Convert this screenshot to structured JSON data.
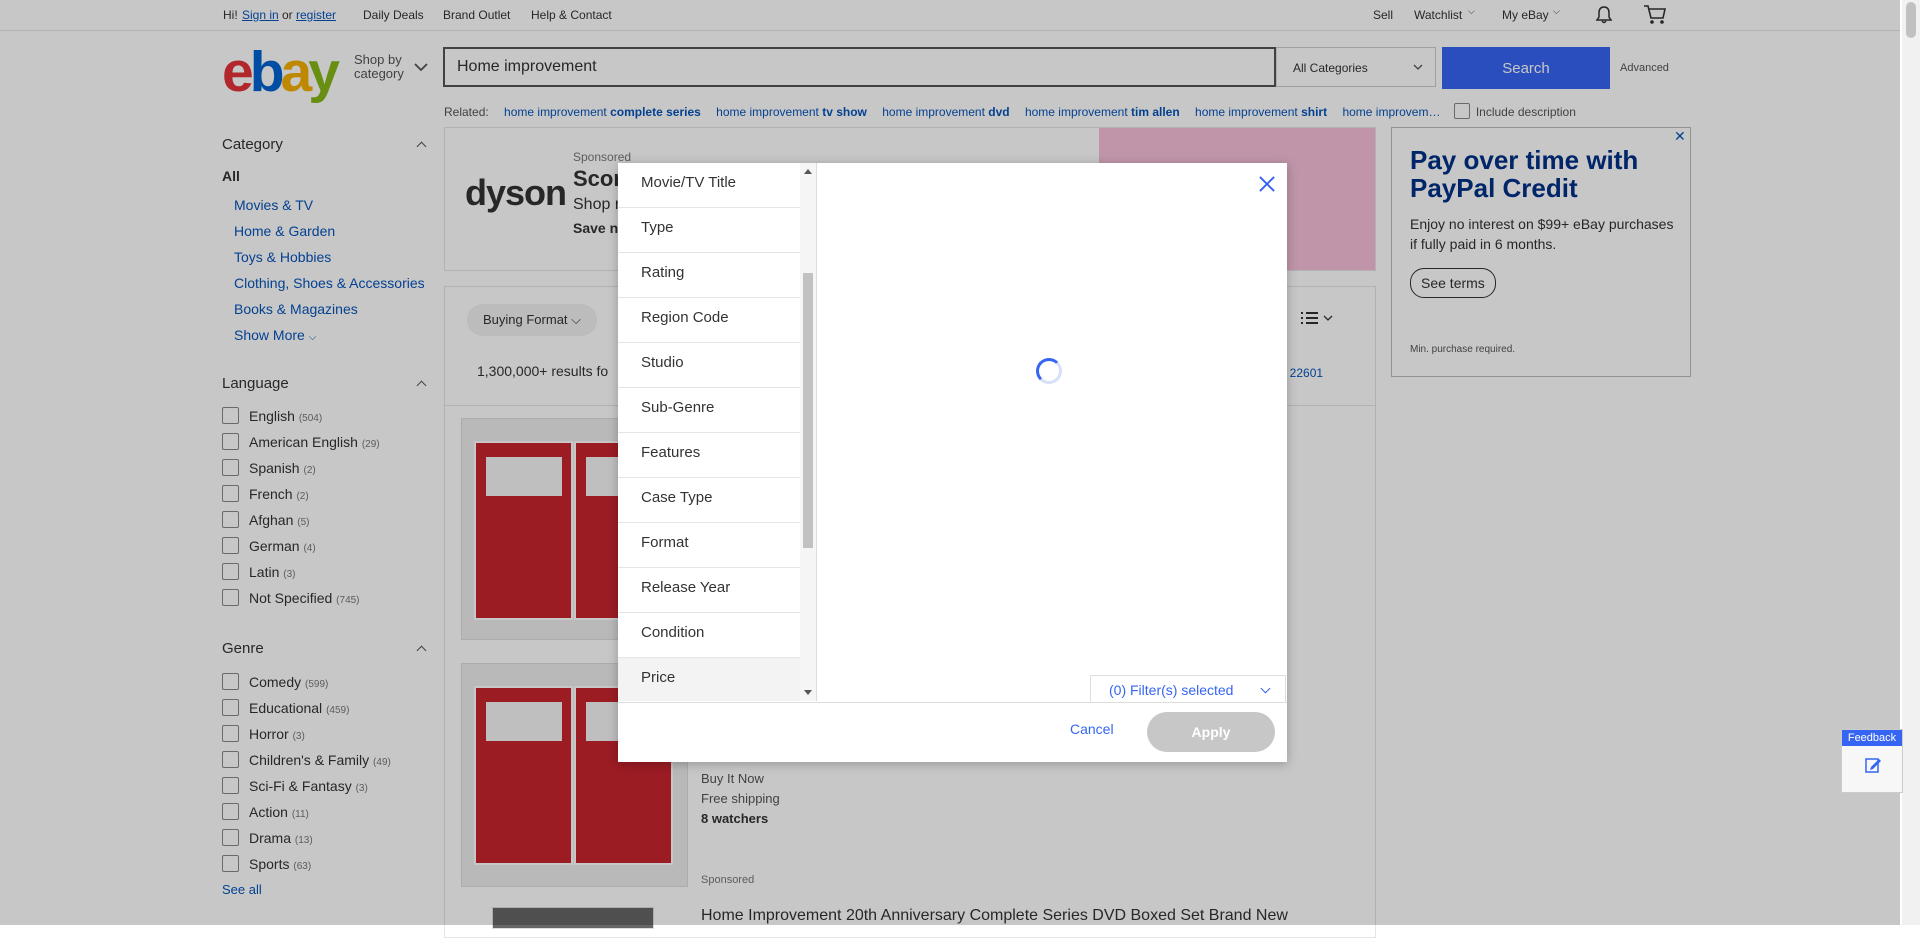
{
  "topbar": {
    "greeting": "Hi!",
    "sign_in": "Sign in",
    "or": "or",
    "register": "register",
    "daily_deals": "Daily Deals",
    "brand_outlet": "Brand Outlet",
    "help": "Help & Contact",
    "sell": "Sell",
    "watchlist": "Watchlist",
    "my_ebay": "My eBay"
  },
  "header": {
    "logo_letters": [
      "e",
      "b",
      "a",
      "y"
    ],
    "shop_by_line1": "Shop by",
    "shop_by_line2": "category",
    "search_value": "Home improvement",
    "category_select": "All Categories",
    "search_button": "Search",
    "advanced": "Advanced"
  },
  "related": {
    "label": "Related:",
    "items": [
      {
        "prefix": "home improvement ",
        "bold": "complete series"
      },
      {
        "prefix": "home improvement ",
        "bold": "tv show"
      },
      {
        "prefix": "home improvement ",
        "bold": "dvd"
      },
      {
        "prefix": "home improvement ",
        "bold": "tim allen"
      },
      {
        "prefix": "home improvement ",
        "bold": "shirt"
      },
      {
        "prefix": "home improvem…",
        "bold": ""
      }
    ],
    "include_description": "Include description"
  },
  "sidebar": {
    "category_heading": "Category",
    "all": "All",
    "categories": [
      "Movies & TV",
      "Home & Garden",
      "Toys & Hobbies",
      "Clothing, Shoes & Accessories",
      "Books & Magazines"
    ],
    "show_more": "Show More",
    "language_heading": "Language",
    "languages": [
      {
        "label": "English",
        "count": "(504)"
      },
      {
        "label": "American English",
        "count": "(29)"
      },
      {
        "label": "Spanish",
        "count": "(2)"
      },
      {
        "label": "French",
        "count": "(2)"
      },
      {
        "label": "Afghan",
        "count": "(5)"
      },
      {
        "label": "German",
        "count": "(4)"
      },
      {
        "label": "Latin",
        "count": "(3)"
      },
      {
        "label": "Not Specified",
        "count": "(745)"
      }
    ],
    "genre_heading": "Genre",
    "genres": [
      {
        "label": "Comedy",
        "count": "(599)"
      },
      {
        "label": "Educational",
        "count": "(459)"
      },
      {
        "label": "Horror",
        "count": "(3)"
      },
      {
        "label": "Children's & Family",
        "count": "(49)"
      },
      {
        "label": "Sci-Fi & Fantasy",
        "count": "(3)"
      },
      {
        "label": "Action",
        "count": "(11)"
      },
      {
        "label": "Drama",
        "count": "(13)"
      },
      {
        "label": "Sports",
        "count": "(63)"
      }
    ],
    "see_all": "See all"
  },
  "main": {
    "sponsored": "Sponsored",
    "ad_brand": "dyson",
    "ad_title": "Scor",
    "ad_sub": "Shop n",
    "ad_save": "Save n",
    "buying_format": "Buying Format",
    "results": "1,300,000+ results fo",
    "zip": ": 22601",
    "listing2_buy": "Buy It Now",
    "listing2_ship": "Free shipping",
    "listing2_watchers": "8 watchers",
    "listing2_sponsored": "Sponsored",
    "listing3_title": "Home Improvement 20th Anniversary Complete Series DVD Boxed Set Brand New"
  },
  "ad_right": {
    "headline": "Pay over time with PayPal Credit",
    "body": "Enjoy no interest on $99+ eBay purchases if fully paid in 6 months.",
    "button": "See terms",
    "fine_print": "Min. purchase required."
  },
  "modal": {
    "aspects": [
      "Movie/TV Title",
      "Type",
      "Rating",
      "Region Code",
      "Studio",
      "Sub-Genre",
      "Features",
      "Case Type",
      "Format",
      "Release Year",
      "Condition",
      "Price"
    ],
    "active_aspect": "Price",
    "filters_selected": "(0) Filter(s) selected",
    "cancel": "Cancel",
    "apply": "Apply"
  },
  "feedback": {
    "label": "Feedback"
  }
}
